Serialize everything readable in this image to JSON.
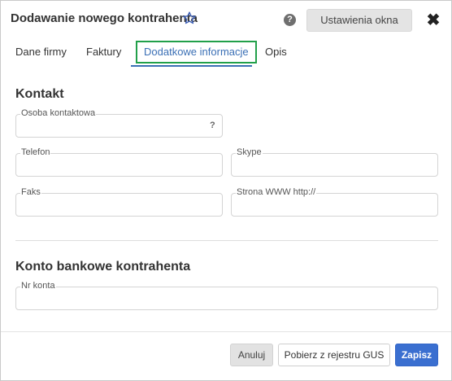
{
  "dialog": {
    "title": "Dodawanie nowego kontrahenta",
    "settings_button": "Ustawienia okna",
    "help_icon_glyph": "?",
    "close_icon_glyph": "✖"
  },
  "tabs": [
    {
      "label": "Dane firmy",
      "active": false
    },
    {
      "label": "Faktury",
      "active": false
    },
    {
      "label": "Dodatkowe informacje",
      "active": true
    },
    {
      "label": "Opis",
      "active": false
    }
  ],
  "contact": {
    "title": "Kontakt",
    "contact_person": {
      "label": "Osoba kontaktowa",
      "value": "",
      "help": "?"
    },
    "phone": {
      "label": "Telefon",
      "value": ""
    },
    "skype": {
      "label": "Skype",
      "value": ""
    },
    "fax": {
      "label": "Faks",
      "value": ""
    },
    "website": {
      "label": "Strona WWW http://",
      "value": ""
    }
  },
  "bank": {
    "title": "Konto bankowe kontrahenta",
    "account_number": {
      "label": "Nr konta",
      "value": ""
    }
  },
  "footer": {
    "cancel": "Anuluj",
    "gus": "Pobierz z rejestru GUS",
    "save": "Zapisz"
  },
  "colors": {
    "active_tab_text": "#3a6fb5",
    "active_tab_border": "#22a04a",
    "save_button": "#3a6fd0"
  }
}
